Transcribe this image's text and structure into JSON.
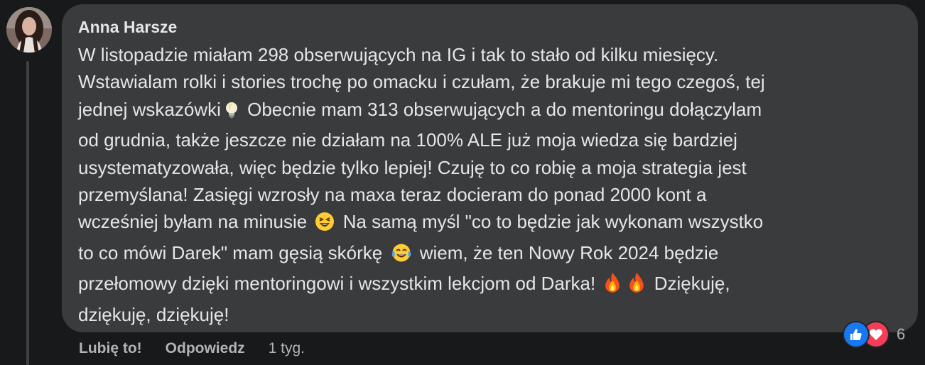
{
  "comment": {
    "author": "Anna Harsze",
    "lines": [
      "W listopadzie miałam 298 obserwujących na IG i tak to stało od kilku miesięcy.",
      "Wstawialam rolki i stories trochę po omacku i czułam, że brakuje mi tego czegoś, tej",
      "jednej wskazówki",
      "Obecnie mam 313 obserwujących a do mentoringu dołączylam",
      "od grudnia, także jeszcze nie działam na 100% ALE już moja wiedza się bardziej",
      "usystematyzowała, więc będzie tylko lepiej! Czuję to co robię a moja strategia jest",
      "przemyślana! Zasięgi wzrosły na maxa teraz docieram do ponad 2000 kont a",
      "wcześniej byłam na minusie",
      "Na samą myśl \"co to będzie jak wykonam wszystko",
      "to co mówi Darek\" mam gęsią skórkę",
      "wiem, że ten Nowy Rok 2024 będzie",
      "przełomowy dzięki mentoringowi i wszystkim lekcjom od Darka!",
      "Dziękuję,",
      "dziękuję, dziękuję!"
    ],
    "emojis": {
      "bulb": "lightbulb-emoji",
      "laugh": "laughing-squint-emoji",
      "joy": "tears-of-joy-emoji",
      "fire": "fire-emoji"
    }
  },
  "actions": {
    "like": "Lubię to!",
    "reply": "Odpowiedz",
    "time": "1 tyg."
  },
  "reactions": {
    "icons": [
      "like-icon",
      "love-icon"
    ],
    "count": "6"
  },
  "colors": {
    "background": "#18191a",
    "bubble": "#3a3b3c",
    "text": "#e4e6eb",
    "secondary": "#b0b3b8",
    "like": "#1877f2",
    "love": "#f33e58"
  }
}
